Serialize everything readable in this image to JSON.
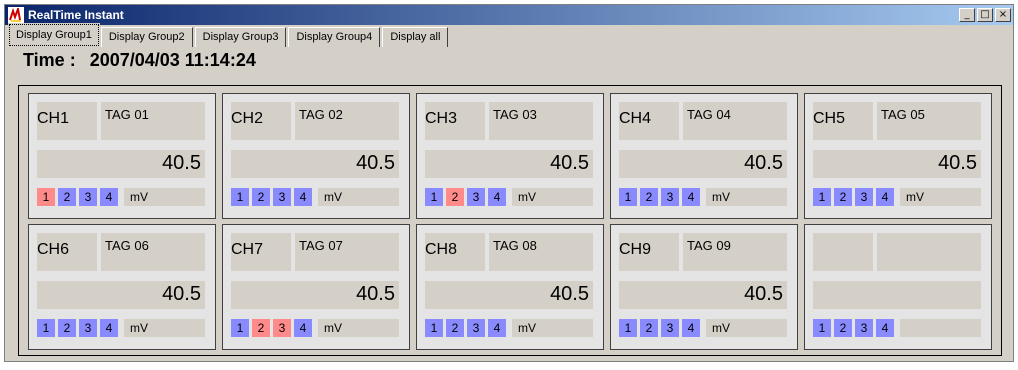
{
  "window": {
    "title": "RealTime Instant",
    "controls": [
      "_",
      "□",
      "×"
    ]
  },
  "tabs": [
    "Display Group1",
    "Display Group2",
    "Display Group3",
    "Display Group4",
    "Display all"
  ],
  "active_tab": 0,
  "time": {
    "label": "Time :",
    "value": "2007/04/03 11:14:24"
  },
  "colors": {
    "badge_normal": "#8a8aff",
    "badge_alarm": "#ff8a8a"
  },
  "channels": [
    {
      "ch": "CH1",
      "tag": "TAG 01",
      "value": "40.5",
      "unit": "mV",
      "badges": [
        "1",
        "2",
        "3",
        "4"
      ],
      "alarms": [
        0
      ]
    },
    {
      "ch": "CH2",
      "tag": "TAG 02",
      "value": "40.5",
      "unit": "mV",
      "badges": [
        "1",
        "2",
        "3",
        "4"
      ],
      "alarms": []
    },
    {
      "ch": "CH3",
      "tag": "TAG 03",
      "value": "40.5",
      "unit": "mV",
      "badges": [
        "1",
        "2",
        "3",
        "4"
      ],
      "alarms": [
        1
      ]
    },
    {
      "ch": "CH4",
      "tag": "TAG 04",
      "value": "40.5",
      "unit": "mV",
      "badges": [
        "1",
        "2",
        "3",
        "4"
      ],
      "alarms": []
    },
    {
      "ch": "CH5",
      "tag": "TAG 05",
      "value": "40.5",
      "unit": "mV",
      "badges": [
        "1",
        "2",
        "3",
        "4"
      ],
      "alarms": []
    },
    {
      "ch": "CH6",
      "tag": "TAG 06",
      "value": "40.5",
      "unit": "mV",
      "badges": [
        "1",
        "2",
        "3",
        "4"
      ],
      "alarms": []
    },
    {
      "ch": "CH7",
      "tag": "TAG 07",
      "value": "40.5",
      "unit": "mV",
      "badges": [
        "1",
        "2",
        "3",
        "4"
      ],
      "alarms": [
        1,
        2
      ]
    },
    {
      "ch": "CH8",
      "tag": "TAG 08",
      "value": "40.5",
      "unit": "mV",
      "badges": [
        "1",
        "2",
        "3",
        "4"
      ],
      "alarms": []
    },
    {
      "ch": "CH9",
      "tag": "TAG 09",
      "value": "40.5",
      "unit": "mV",
      "badges": [
        "1",
        "2",
        "3",
        "4"
      ],
      "alarms": []
    },
    {
      "ch": "",
      "tag": "",
      "value": "",
      "unit": "",
      "badges": [
        "1",
        "2",
        "3",
        "4"
      ],
      "alarms": []
    }
  ]
}
